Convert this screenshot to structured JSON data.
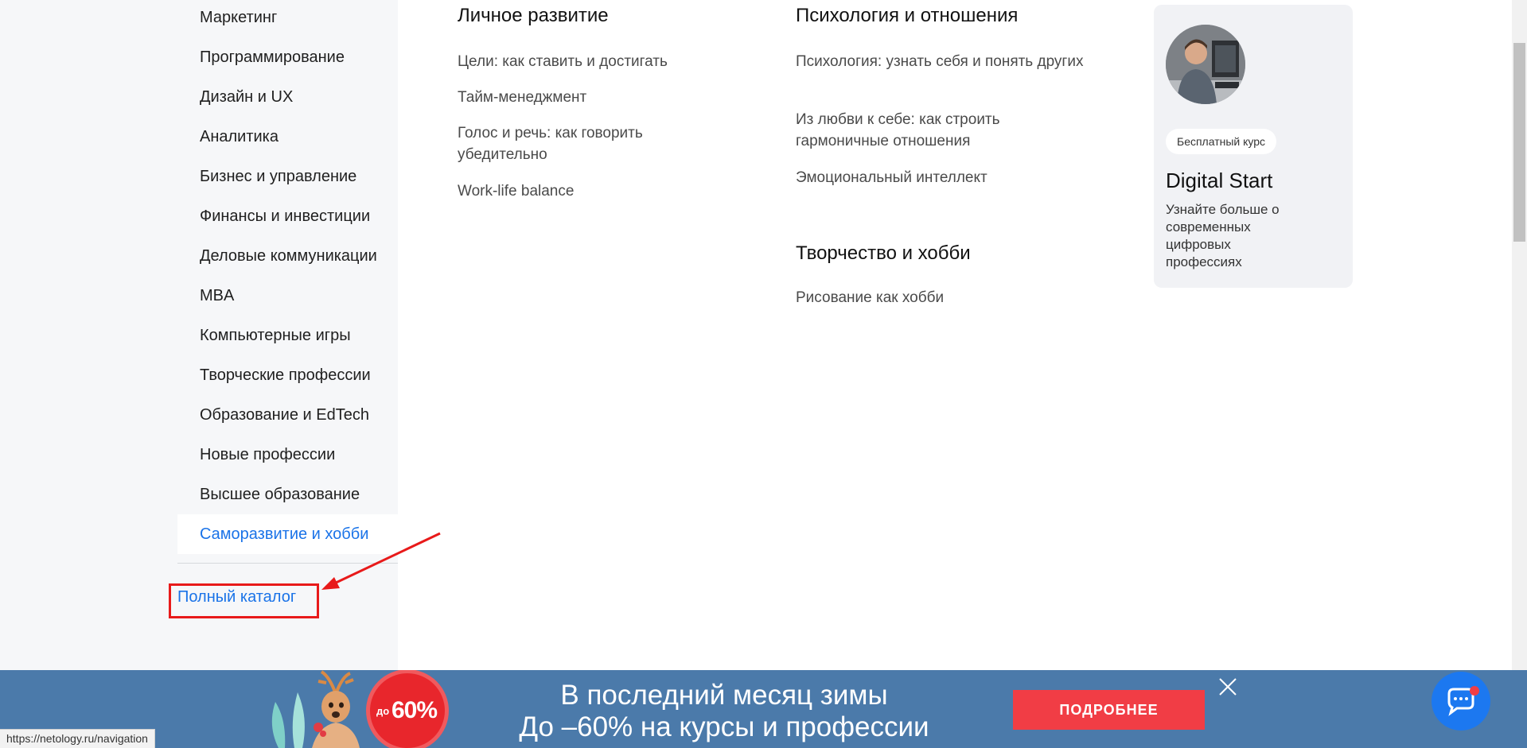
{
  "sidebar": {
    "items": [
      {
        "label": "Маркетинг"
      },
      {
        "label": "Программирование"
      },
      {
        "label": "Дизайн и UX"
      },
      {
        "label": "Аналитика"
      },
      {
        "label": "Бизнес и управление"
      },
      {
        "label": "Финансы и инвестиции"
      },
      {
        "label": "Деловые коммуникации"
      },
      {
        "label": "MBA"
      },
      {
        "label": "Компьютерные игры"
      },
      {
        "label": "Творческие профессии"
      },
      {
        "label": "Образование и EdTech"
      },
      {
        "label": "Новые профессии"
      },
      {
        "label": "Высшее образование"
      },
      {
        "label": "Саморазвитие и хобби",
        "active": true
      }
    ],
    "catalog_link": "Полный каталог"
  },
  "columns": {
    "personal": {
      "title": "Личное развитие",
      "links": [
        "Цели: как ставить и достигать",
        "Тайм-менеджмент",
        "Голос и речь: как говорить убедительно",
        "Work-life balance"
      ]
    },
    "psychology": {
      "title": "Психология и отношения",
      "links": [
        "Психология: узнать себя и понять других",
        "Из любви к себе: как строить гармоничные отношения",
        "Эмоциональный интеллект"
      ]
    },
    "creative": {
      "title": "Творчество и хобби",
      "links": [
        "Рисование как хобби"
      ]
    }
  },
  "promo": {
    "badge": "Бесплатный курс",
    "title": "Digital Start",
    "description": "Узнайте больше о современных цифровых профессиях"
  },
  "banner": {
    "line1": "В последний месяц зимы",
    "line2": "До –60% на курсы и профессии",
    "button": "ПОДРОБНЕЕ",
    "sale_prefix": "до",
    "sale_value": "60%"
  },
  "status_bar": {
    "url": "https://netology.ru/navigation"
  },
  "colors": {
    "accent": "#1a73e8",
    "highlight": "#e81a1a",
    "banner_bg": "#4b7aaa",
    "button_bg": "#f13d45",
    "chat_bg": "#1c78f0"
  }
}
